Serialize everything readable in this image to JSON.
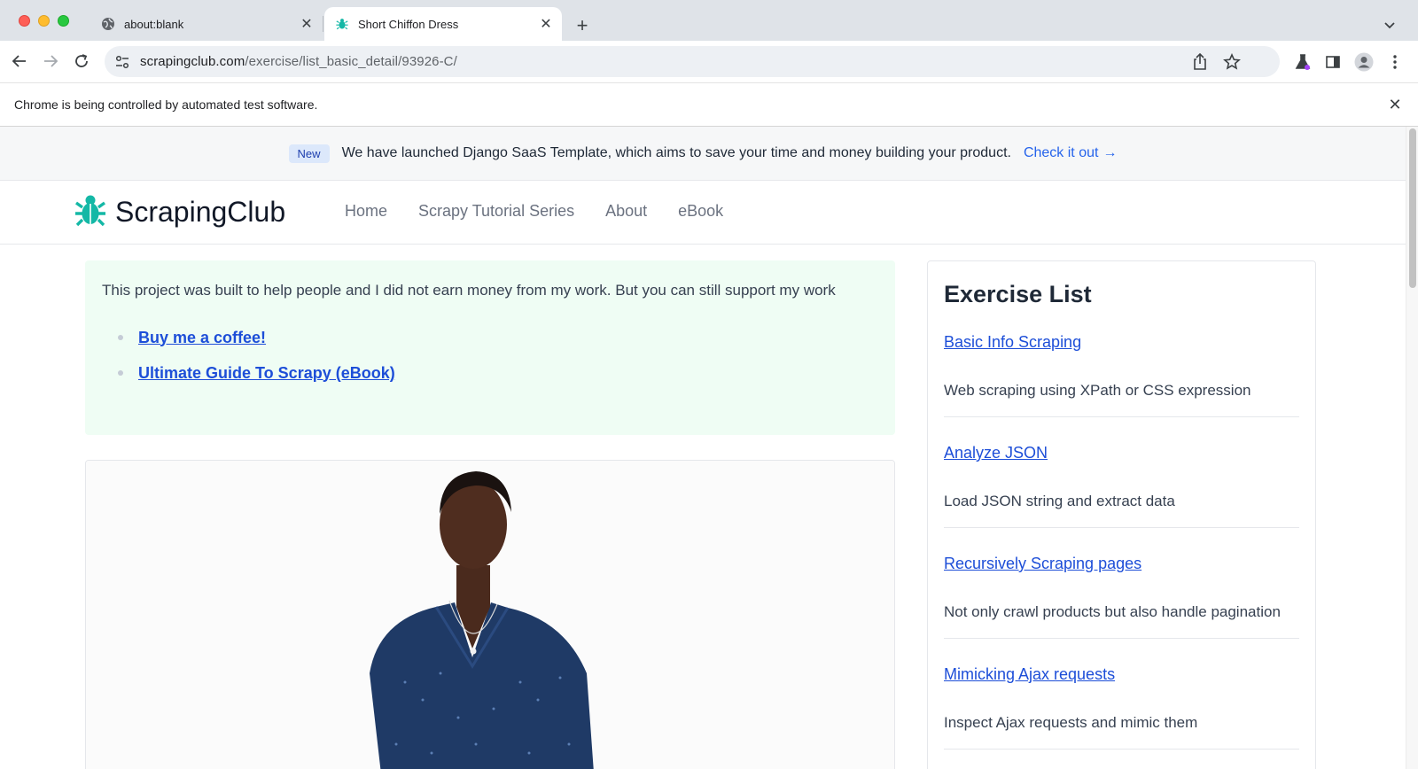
{
  "browser": {
    "tabs": [
      {
        "title": "about:blank",
        "active": false,
        "icon": "globe-icon"
      },
      {
        "title": "Short Chiffon Dress",
        "active": true,
        "icon": "bug-icon"
      }
    ],
    "url_host": "scrapingclub.com",
    "url_path": "/exercise/list_basic_detail/93926-C/",
    "infobar_message": "Chrome is being controlled by automated test software."
  },
  "announcement": {
    "badge": "New",
    "text": "We have launched Django SaaS Template, which aims to save your time and money building your product.",
    "cta": "Check it out"
  },
  "site": {
    "brand": "ScrapingClub",
    "brand_color": "#14b8a6",
    "nav": [
      "Home",
      "Scrapy Tutorial Series",
      "About",
      "eBook"
    ]
  },
  "support": {
    "text": "This project was built to help people and I did not earn money from my work. But you can still support my work",
    "links": [
      "Buy me a coffee!",
      "Ultimate Guide To Scrapy (eBook)"
    ]
  },
  "sidebar": {
    "heading": "Exercise List",
    "items": [
      {
        "title": "Basic Info Scraping",
        "desc": "Web scraping using XPath or CSS expression"
      },
      {
        "title": "Analyze JSON",
        "desc": "Load JSON string and extract data"
      },
      {
        "title": "Recursively Scraping pages",
        "desc": "Not only crawl products but also handle pagination"
      },
      {
        "title": "Mimicking Ajax requests",
        "desc": "Inspect Ajax requests and mimic them"
      }
    ]
  }
}
